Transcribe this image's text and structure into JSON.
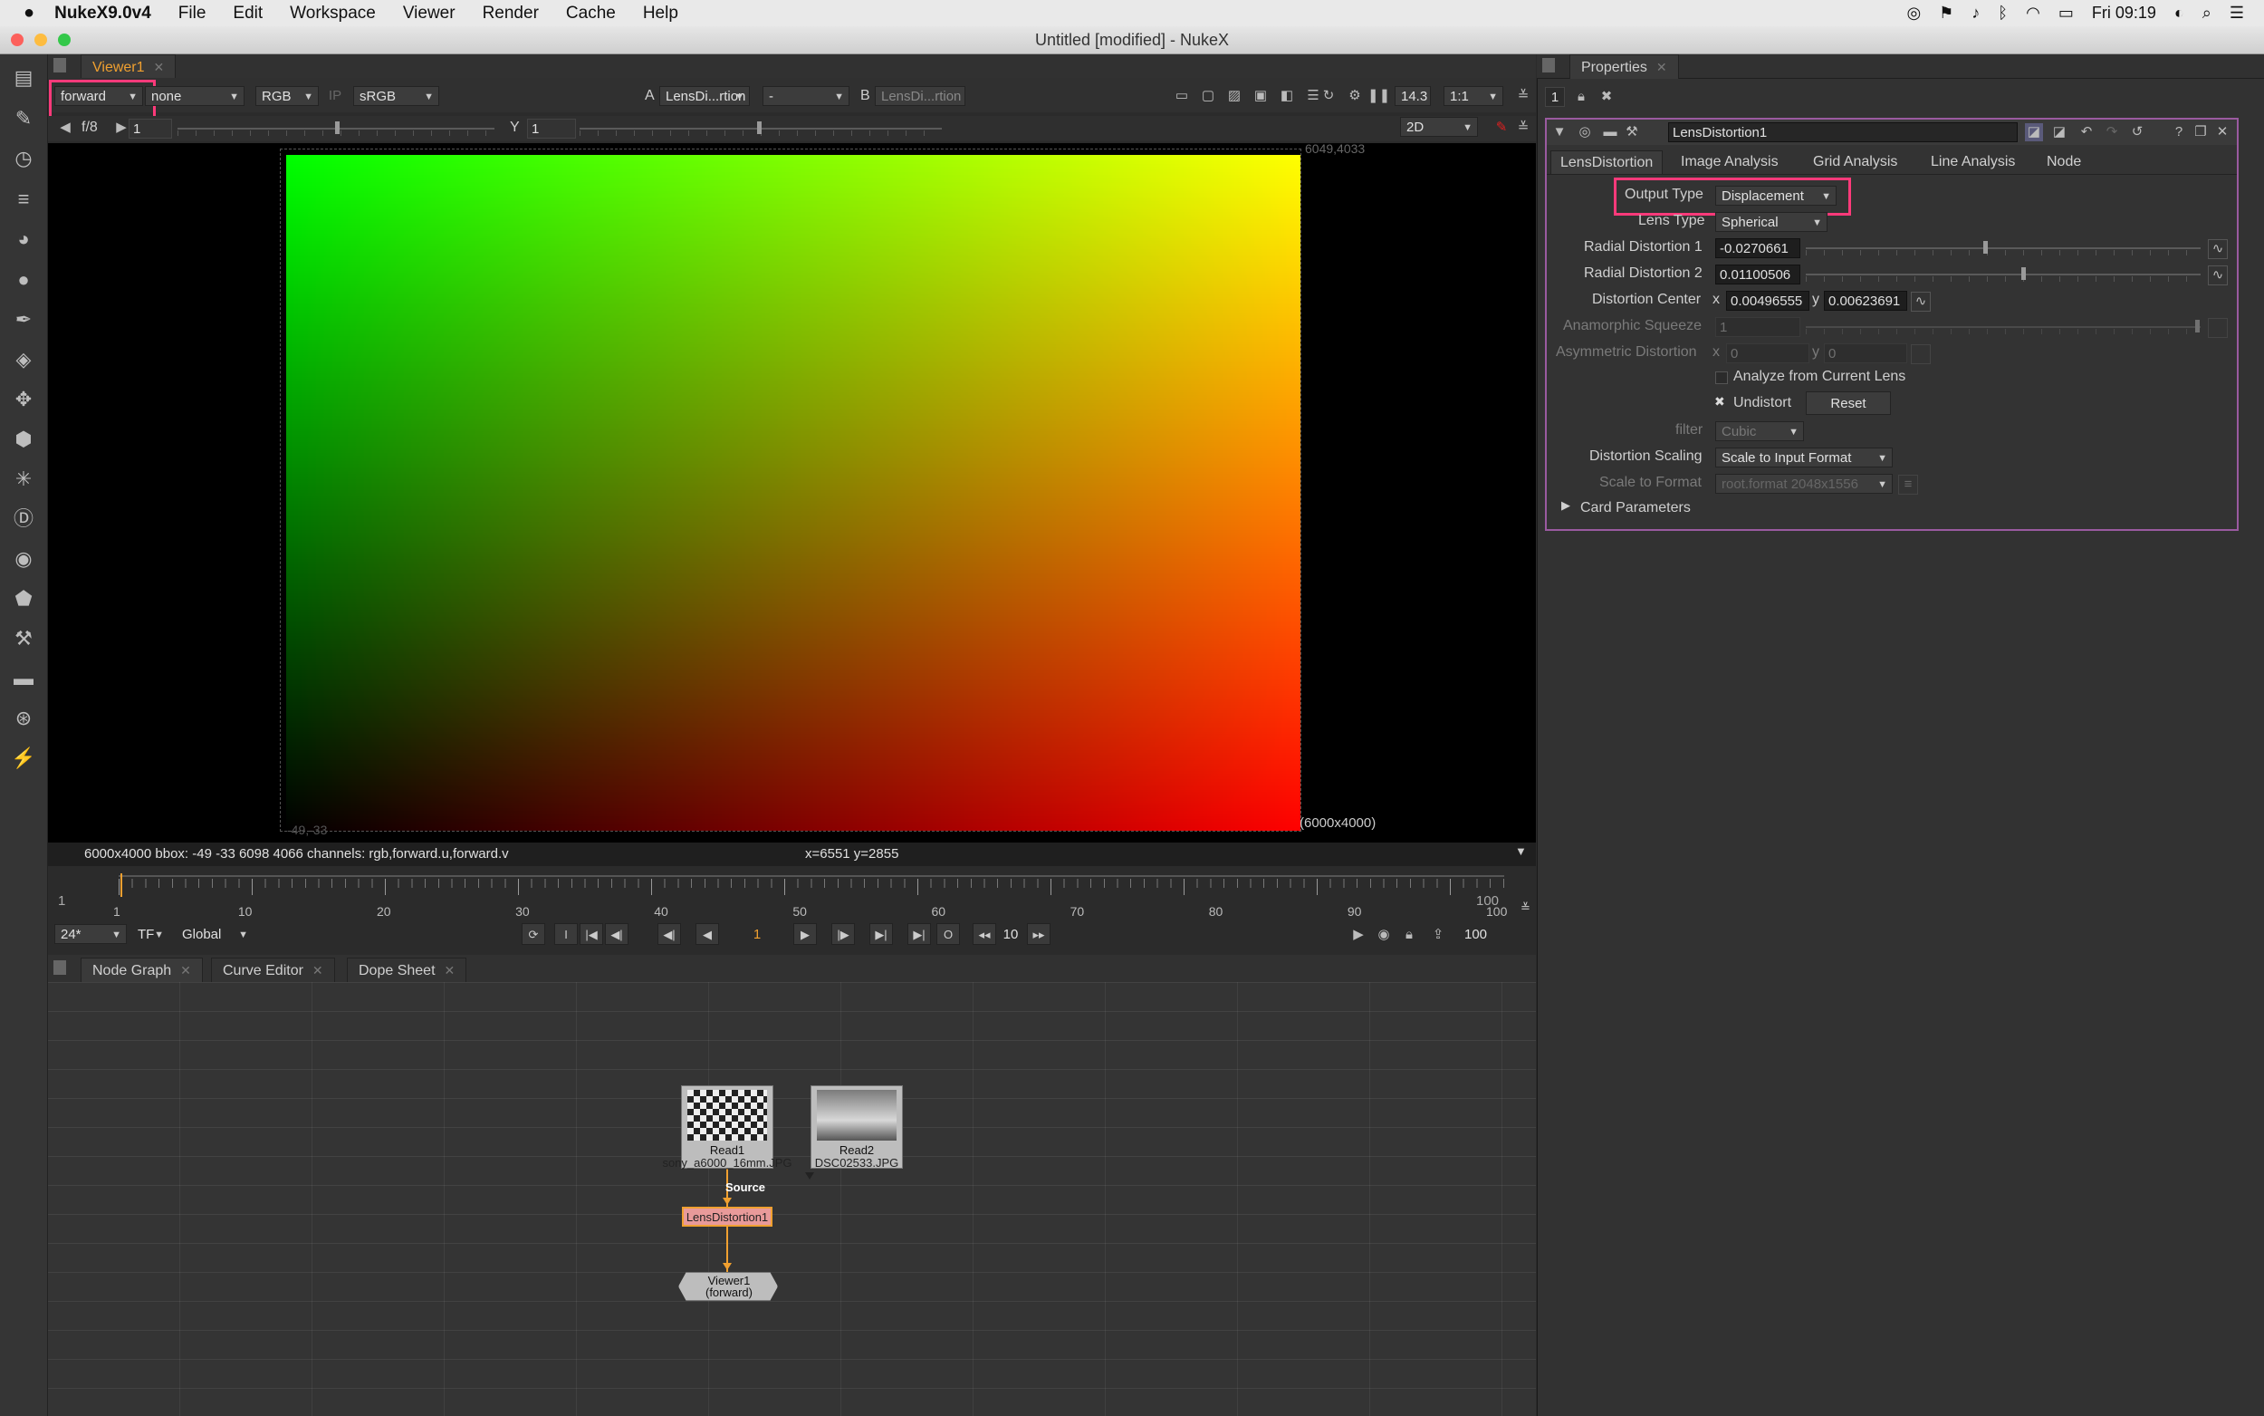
{
  "menubar": {
    "app": "NukeX9.0v4",
    "items": [
      "File",
      "Edit",
      "Workspace",
      "Viewer",
      "Render",
      "Cache",
      "Help"
    ],
    "clock": "Fri 09:19"
  },
  "window": {
    "title": "Untitled [modified] - NukeX"
  },
  "viewer": {
    "tab": "Viewer1",
    "layer": "forward",
    "alpha": "none",
    "channel": "RGB",
    "colorspace": "sRGB",
    "a_label": "A",
    "a_input": "LensDi...rtion",
    "b_op": "-",
    "b_label": "B",
    "b_input": "LensDi...rtion",
    "zoom": "14.3",
    "ratio": "1:1",
    "fstop": "f/8",
    "gain": "1",
    "y_label": "Y",
    "gamma": "1",
    "mode": "2D",
    "bbox_tr": "6049,4033",
    "bbox_bl": "-49,-33",
    "format_label": "(6000x4000)",
    "info": "6000x4000  bbox: -49 -33 6098 4066 channels: rgb,forward.u,forward.v",
    "coords": "x=6551 y=2855"
  },
  "timeline": {
    "start": "1",
    "end": "100",
    "ticks": [
      "1",
      "10",
      "20",
      "30",
      "40",
      "50",
      "60",
      "70",
      "80",
      "90",
      "100"
    ],
    "fps": "24*",
    "tf": "TF",
    "scope": "Global",
    "frame": "1",
    "step": "10",
    "out": "100",
    "current": 1
  },
  "bottom_tabs": [
    "Node Graph",
    "Curve Editor",
    "Dope Sheet"
  ],
  "nodes": {
    "read1_name": "Read1",
    "read1_file": "sony_a6000_16mm.JPG",
    "read2_name": "Read2",
    "read2_file": "DSC02533.JPG",
    "source_label": "Source",
    "lens": "LensDistortion1",
    "viewer_name": "Viewer1",
    "viewer_sub": "(forward)"
  },
  "properties": {
    "tab": "Properties",
    "count": "1",
    "node_name": "LensDistortion1",
    "tabs": [
      "LensDistortion",
      "Image Analysis",
      "Grid Analysis",
      "Line Analysis",
      "Node"
    ],
    "output_type_label": "Output Type",
    "output_type": "Displacement",
    "lens_type_label": "Lens Type",
    "lens_type": "Spherical",
    "radial1_label": "Radial Distortion 1",
    "radial1": "-0.0270661",
    "radial2_label": "Radial Distortion 2",
    "radial2": "0.01100506",
    "center_label": "Distortion Center",
    "center_x_label": "x",
    "center_x": "0.00496555",
    "center_y_label": "y",
    "center_y": "0.00623691",
    "anamorphic_label": "Anamorphic Squeeze",
    "anamorphic": "1",
    "asym_label": "Asymmetric Distortion",
    "asym_x_label": "x",
    "asym_x": "0",
    "asym_y_label": "y",
    "asym_y": "0",
    "analyze_label": "Analyze from Current Lens",
    "undistort_label": "Undistort",
    "reset_label": "Reset",
    "filter_label": "filter",
    "filter": "Cubic",
    "scaling_label": "Distortion Scaling",
    "scaling": "Scale to Input Format",
    "scale_format_label": "Scale to Format",
    "scale_format": "root.format 2048x1556",
    "card_label": "Card Parameters"
  },
  "colors": {
    "highlight": "#ff3a7a",
    "timeline_marker": "#f0a030"
  }
}
